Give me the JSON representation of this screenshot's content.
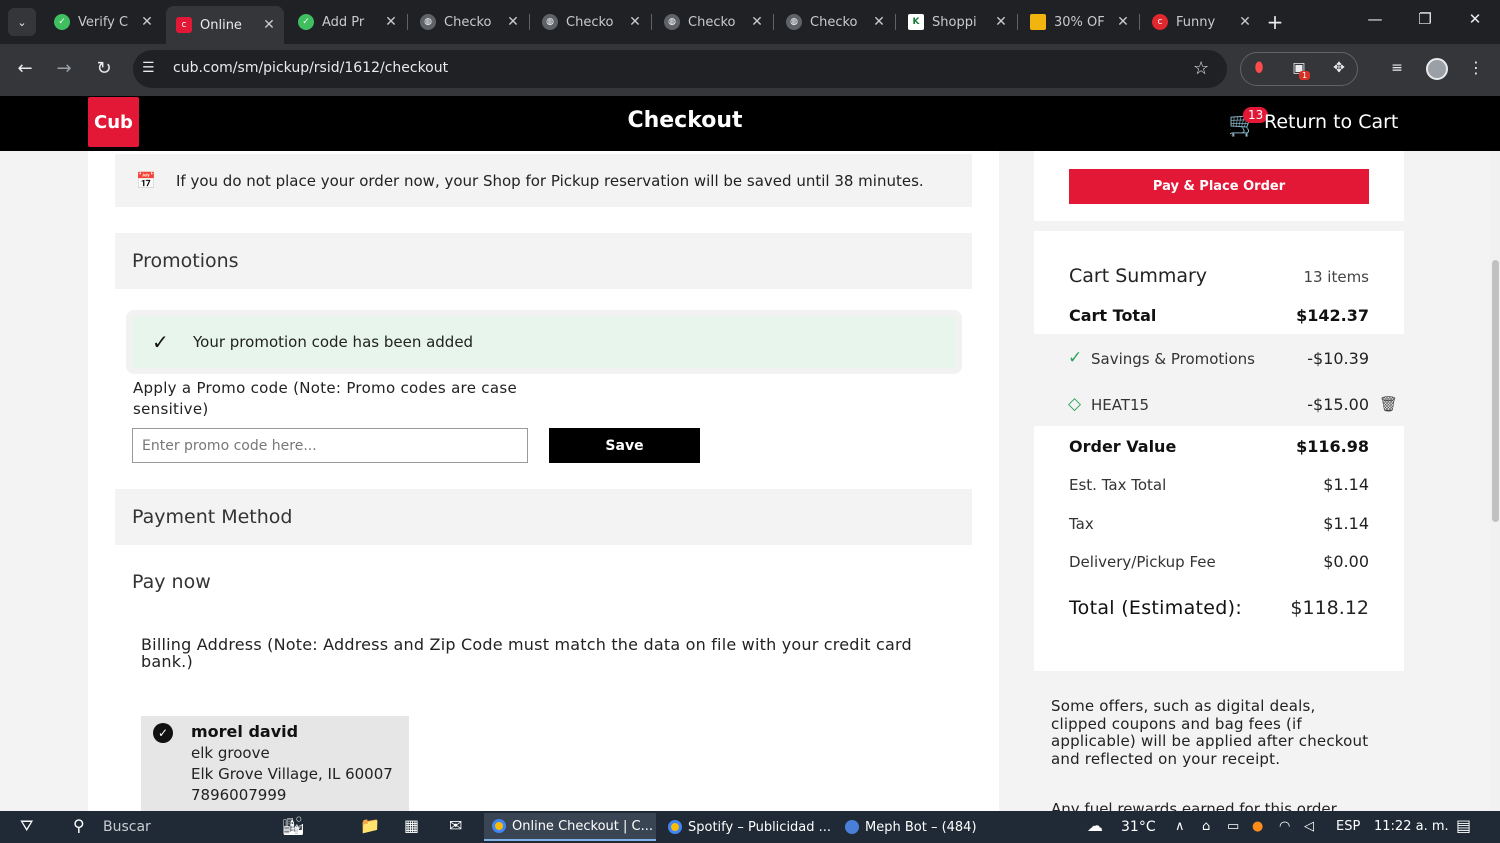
{
  "browser": {
    "tabs": [
      {
        "title": "Verify C",
        "favicon": "check-circle-green"
      },
      {
        "title": "Online",
        "favicon": "cub-logo"
      },
      {
        "title": "Add Pr",
        "favicon": "check-circle-green"
      },
      {
        "title": "Checko",
        "favicon": "globe"
      },
      {
        "title": "Checko",
        "favicon": "globe"
      },
      {
        "title": "Checko",
        "favicon": "globe"
      },
      {
        "title": "Checko",
        "favicon": "globe"
      },
      {
        "title": "Shoppi",
        "favicon": "k-logo"
      },
      {
        "title": "30% OF",
        "favicon": "folder-yellow"
      },
      {
        "title": "Funny",
        "favicon": "red-circle"
      }
    ],
    "url": "cub.com/sm/pickup/rsid/1612/checkout",
    "extension_badge": "1"
  },
  "header": {
    "logo_text": "Cub",
    "title": "Checkout",
    "cart_count": "13",
    "return_label": "Return to Cart"
  },
  "notice": {
    "text": "If you do not place your order now, your Shop for Pickup reservation will be saved until 38 minutes."
  },
  "promotions": {
    "title": "Promotions",
    "success_message": "Your promotion code has been added",
    "apply_label": "Apply a Promo code (Note: Promo codes are case sensitive)",
    "input_placeholder": "Enter promo code here...",
    "input_value": "",
    "save_label": "Save"
  },
  "payment": {
    "title": "Payment Method",
    "pay_now": "Pay now",
    "billing_note": "Billing Address (Note: Address and Zip Code must match the data on file with your credit card bank.)",
    "address": {
      "name": "morel david",
      "line1": "elk groove",
      "line2": "Elk Grove Village, IL 60007",
      "phone": "7896007999"
    }
  },
  "sidebar": {
    "pay_button": "Pay & Place Order",
    "summary_title": "Cart Summary",
    "item_count": "13 items",
    "rows": {
      "cart_total": {
        "label": "Cart Total",
        "value": "$142.37"
      },
      "savings": {
        "label": "Savings & Promotions",
        "value": "-$10.39"
      },
      "promo": {
        "label": "HEAT15",
        "value": "-$15.00"
      },
      "order_value": {
        "label": "Order Value",
        "value": "$116.98"
      },
      "tax_total": {
        "label": "Est. Tax Total",
        "value": "$1.14"
      },
      "tax": {
        "label": "Tax",
        "value": "$1.14"
      },
      "fee": {
        "label": "Delivery/Pickup Fee",
        "value": "$0.00"
      }
    },
    "total": {
      "label": "Total (Estimated):",
      "value": "$118.12"
    },
    "offers_text": "Some offers, such as digital deals, clipped coupons and bag fees (if applicable) will be applied after checkout and reflected on your receipt.",
    "fuel_text": "Any fuel rewards earned for this order"
  },
  "taskbar": {
    "search": "Buscar",
    "apps": [
      "Online Checkout | C...",
      "Spotify – Publicidad ...",
      "Meph Bot – (484)"
    ],
    "weather": "31°C",
    "language": "ESP",
    "time": "11:22 a. m."
  },
  "colors": {
    "brand_red": "#e31837",
    "success_bg": "#e7f5ec",
    "savings_green": "#2aa35a"
  }
}
